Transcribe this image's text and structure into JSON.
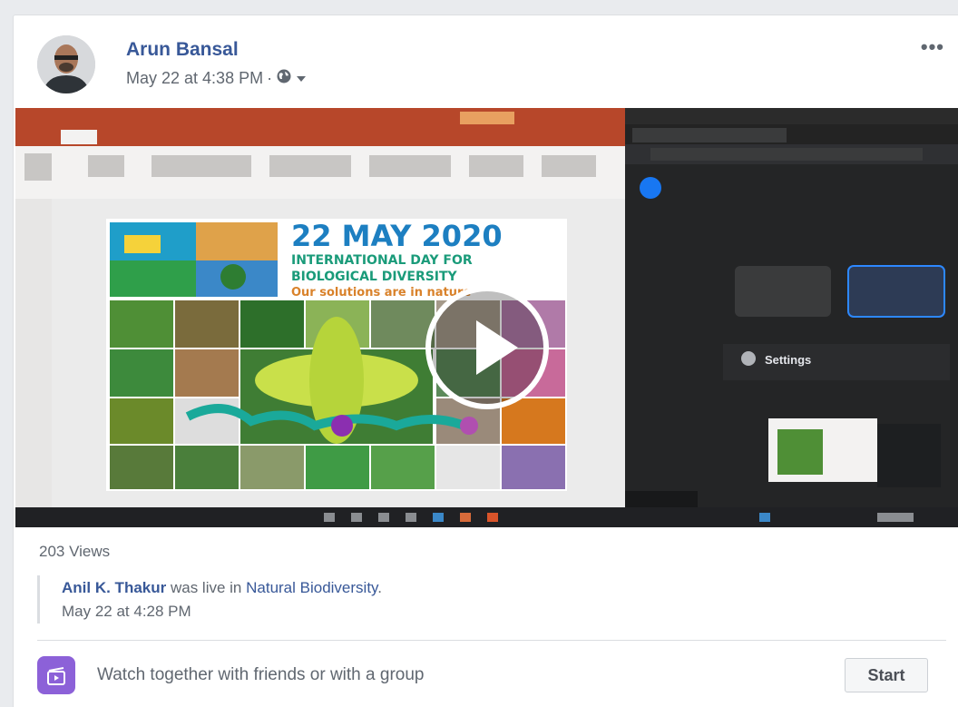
{
  "post": {
    "author": "Arun Bansal",
    "timestamp": "May 22 at 4:38 PM",
    "separator": "·",
    "privacy_icon": "globe-icon"
  },
  "video": {
    "slide_date": "22 MAY 2020",
    "slide_line1": "INTERNATIONAL DAY FOR",
    "slide_line2": "BIOLOGICAL DIVERSITY",
    "slide_line3": "Our solutions are in nature",
    "panel_settings": "Settings"
  },
  "stats": {
    "views": "203 Views"
  },
  "shared": {
    "user": "Anil K. Thakur",
    "action": " was live in ",
    "page": "Natural Biodiversity",
    "period": ".",
    "time": "May 22 at 4:28 PM"
  },
  "watch": {
    "text": "Watch together with friends or with a group",
    "button": "Start"
  }
}
